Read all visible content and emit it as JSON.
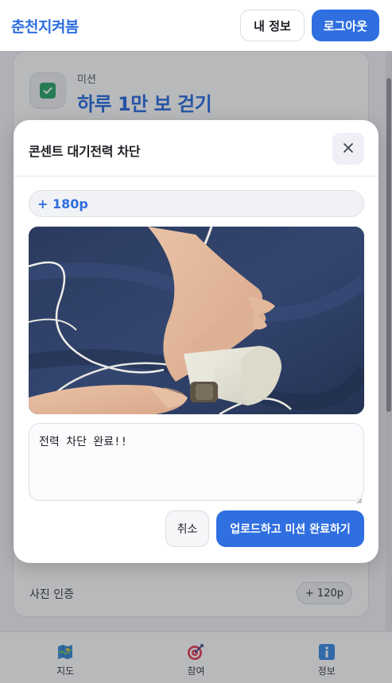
{
  "header": {
    "brand": "춘천지켜봄",
    "profile_label": "내 정보",
    "logout_label": "로그아웃"
  },
  "background_card": {
    "mission_label": "미션",
    "mission_title": "하루 1만 보 걷기",
    "photo_verify_label": "사진 인증",
    "photo_verify_points": "+ 120p"
  },
  "modal": {
    "title": "콘센트 대기전력 차단",
    "points": "+ 180p",
    "photo_alt": "hand unplugging power plug",
    "memo_value": "전력 차단 완료!!",
    "cancel_label": "취소",
    "submit_label": "업로드하고 미션 완료하기"
  },
  "bottom_nav": {
    "items": [
      {
        "label": "지도",
        "icon": "map-icon"
      },
      {
        "label": "참여",
        "icon": "target-icon"
      },
      {
        "label": "정보",
        "icon": "info-icon"
      }
    ]
  },
  "colors": {
    "accent": "#2f6fe0",
    "check_green": "#2fa66a",
    "overlay": "rgba(20,22,30,0.30)"
  }
}
